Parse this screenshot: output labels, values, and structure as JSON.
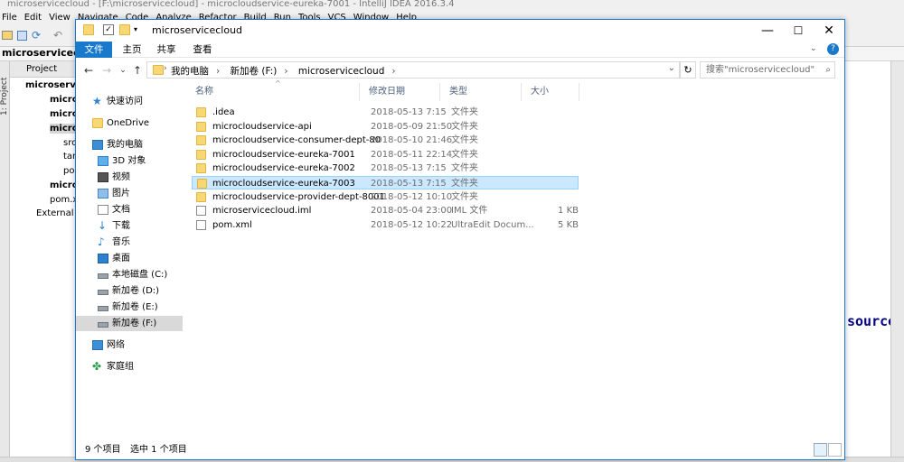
{
  "ide": {
    "title": "microservicecloud - [F:\\microservicecloud] - microcloudservice-eureka-7001 - IntelliJ IDEA 2016.3.4",
    "menu": [
      "File",
      "Edit",
      "View",
      "Navigate",
      "Code",
      "Analyze",
      "Refactor",
      "Build",
      "Run",
      "Tools",
      "VCS",
      "Window",
      "Help"
    ],
    "nav_title": "microservicecloud",
    "project_tab": "Project",
    "side_tab": "1: Project",
    "tree": [
      "microserv",
      "microc",
      "microc",
      "microc",
      "src",
      "tar",
      "po",
      "microc",
      "pom.x",
      "External L"
    ],
    "editor_text": "source"
  },
  "explorer": {
    "title": "microservicecloud",
    "ribbon_tabs": [
      "文件",
      "主页",
      "共享",
      "查看"
    ],
    "address_path": [
      "我的电脑",
      "新加卷 (F:)",
      "microservicecloud"
    ],
    "search_placeholder": "搜索\"microservicecloud\"",
    "nav_items": [
      {
        "label": "快速访问",
        "icon": "star-icon"
      },
      {
        "label": "OneDrive",
        "icon": "folder-icon"
      },
      {
        "label": "我的电脑",
        "icon": "computer-icon"
      },
      {
        "label": "3D 对象",
        "icon": "cube-icon"
      },
      {
        "label": "视频",
        "icon": "video-icon"
      },
      {
        "label": "图片",
        "icon": "picture-icon"
      },
      {
        "label": "文档",
        "icon": "document-icon"
      },
      {
        "label": "下载",
        "icon": "download-icon"
      },
      {
        "label": "音乐",
        "icon": "music-icon"
      },
      {
        "label": "桌面",
        "icon": "desktop-icon"
      },
      {
        "label": "本地磁盘 (C:)",
        "icon": "drive-icon"
      },
      {
        "label": "新加卷 (D:)",
        "icon": "drive-icon"
      },
      {
        "label": "新加卷 (E:)",
        "icon": "drive-icon"
      },
      {
        "label": "新加卷 (F:)",
        "icon": "drive-icon"
      },
      {
        "label": "网络",
        "icon": "network-icon"
      },
      {
        "label": "家庭组",
        "icon": "homegroup-icon"
      }
    ],
    "columns": [
      "名称",
      "修改日期",
      "类型",
      "大小"
    ],
    "files": [
      {
        "name": ".idea",
        "date": "2018-05-13 7:15",
        "type": "文件夹",
        "size": "",
        "kind": "folder"
      },
      {
        "name": "microcloudservice-api",
        "date": "2018-05-09 21:50",
        "type": "文件夹",
        "size": "",
        "kind": "folder"
      },
      {
        "name": "microcloudservice-consumer-dept-80",
        "date": "2018-05-10 21:46",
        "type": "文件夹",
        "size": "",
        "kind": "folder"
      },
      {
        "name": "microcloudservice-eureka-7001",
        "date": "2018-05-11 22:14",
        "type": "文件夹",
        "size": "",
        "kind": "folder"
      },
      {
        "name": "microcloudservice-eureka-7002",
        "date": "2018-05-13 7:15",
        "type": "文件夹",
        "size": "",
        "kind": "folder"
      },
      {
        "name": "microcloudservice-eureka-7003",
        "date": "2018-05-13 7:15",
        "type": "文件夹",
        "size": "",
        "kind": "folder"
      },
      {
        "name": "microcloudservice-provider-dept-8001",
        "date": "2018-05-12 10:10",
        "type": "文件夹",
        "size": "",
        "kind": "folder"
      },
      {
        "name": "microservicecloud.iml",
        "date": "2018-05-04 23:00",
        "type": "IML 文件",
        "size": "1 KB",
        "kind": "file"
      },
      {
        "name": "pom.xml",
        "date": "2018-05-12 10:22",
        "type": "UltraEdit Docum...",
        "size": "5 KB",
        "kind": "file"
      }
    ],
    "status_count": "9 个项目",
    "status_selected": "选中 1 个项目"
  },
  "colors": {
    "accent": "#1979ca",
    "selection": "#cce8ff",
    "folder": "#f8d775"
  }
}
